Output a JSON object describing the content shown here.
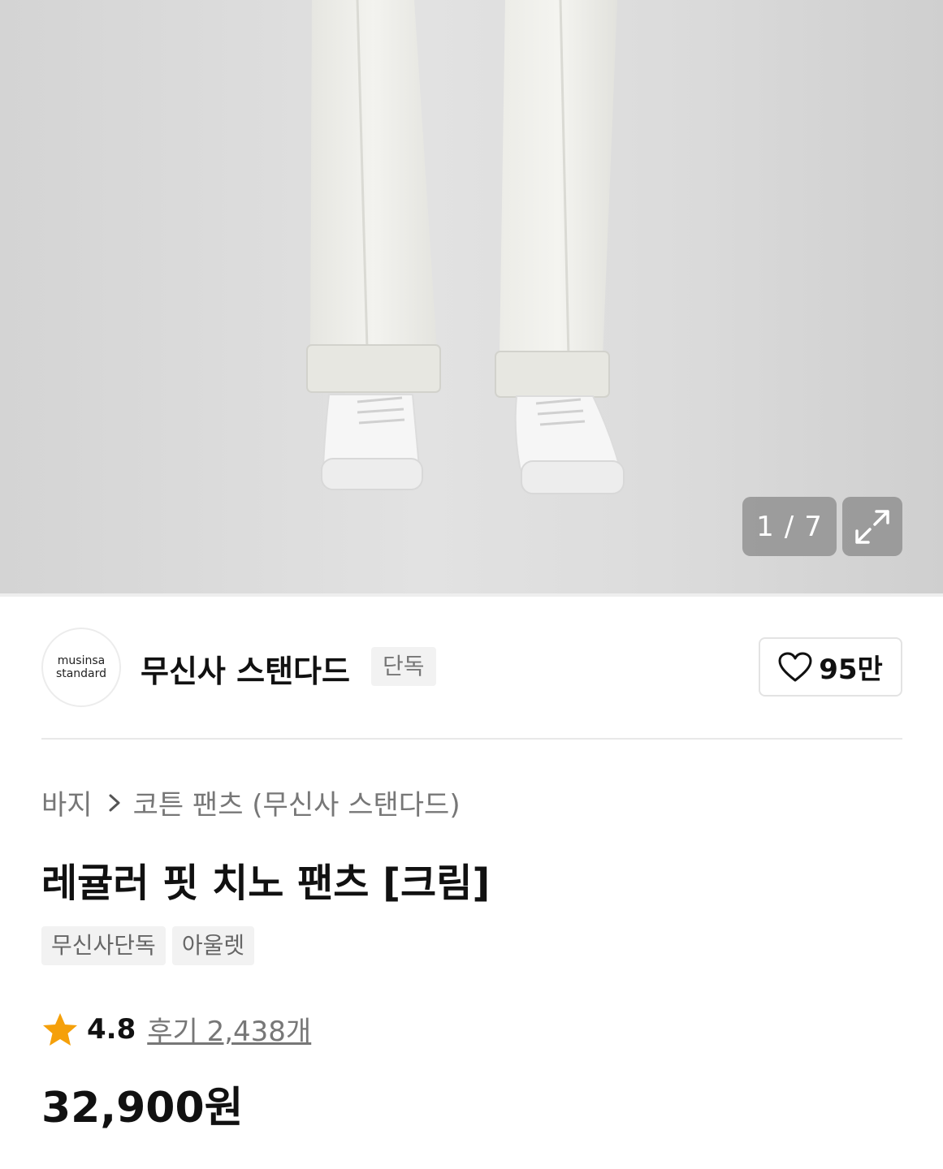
{
  "gallery": {
    "counter_current": "1",
    "counter_separator": "/",
    "counter_total": "7",
    "expand_icon": "expand-arrows-icon"
  },
  "brand": {
    "logo_line1": "musinsa",
    "logo_line2": "standard",
    "name": "무신사 스탠다드",
    "badge": "단독",
    "like_icon": "heart-outline-icon",
    "like_count": "95만"
  },
  "breadcrumb": {
    "level1": "바지",
    "separator_icon": "chevron-right-icon",
    "level2": "코튼 팬츠 (무신사 스탠다드)"
  },
  "product": {
    "title": "레귤러 핏 치노 팬츠 [크림]",
    "tags": [
      "무신사단독",
      "아울렛"
    ],
    "rating_icon": "star-icon",
    "rating": "4.8",
    "reviews": "후기 2,438개",
    "price": "32,900원"
  },
  "colors": {
    "star": "#f5a00a",
    "text_primary": "#111111",
    "text_secondary": "#777777",
    "tag_bg": "#f2f2f2"
  }
}
